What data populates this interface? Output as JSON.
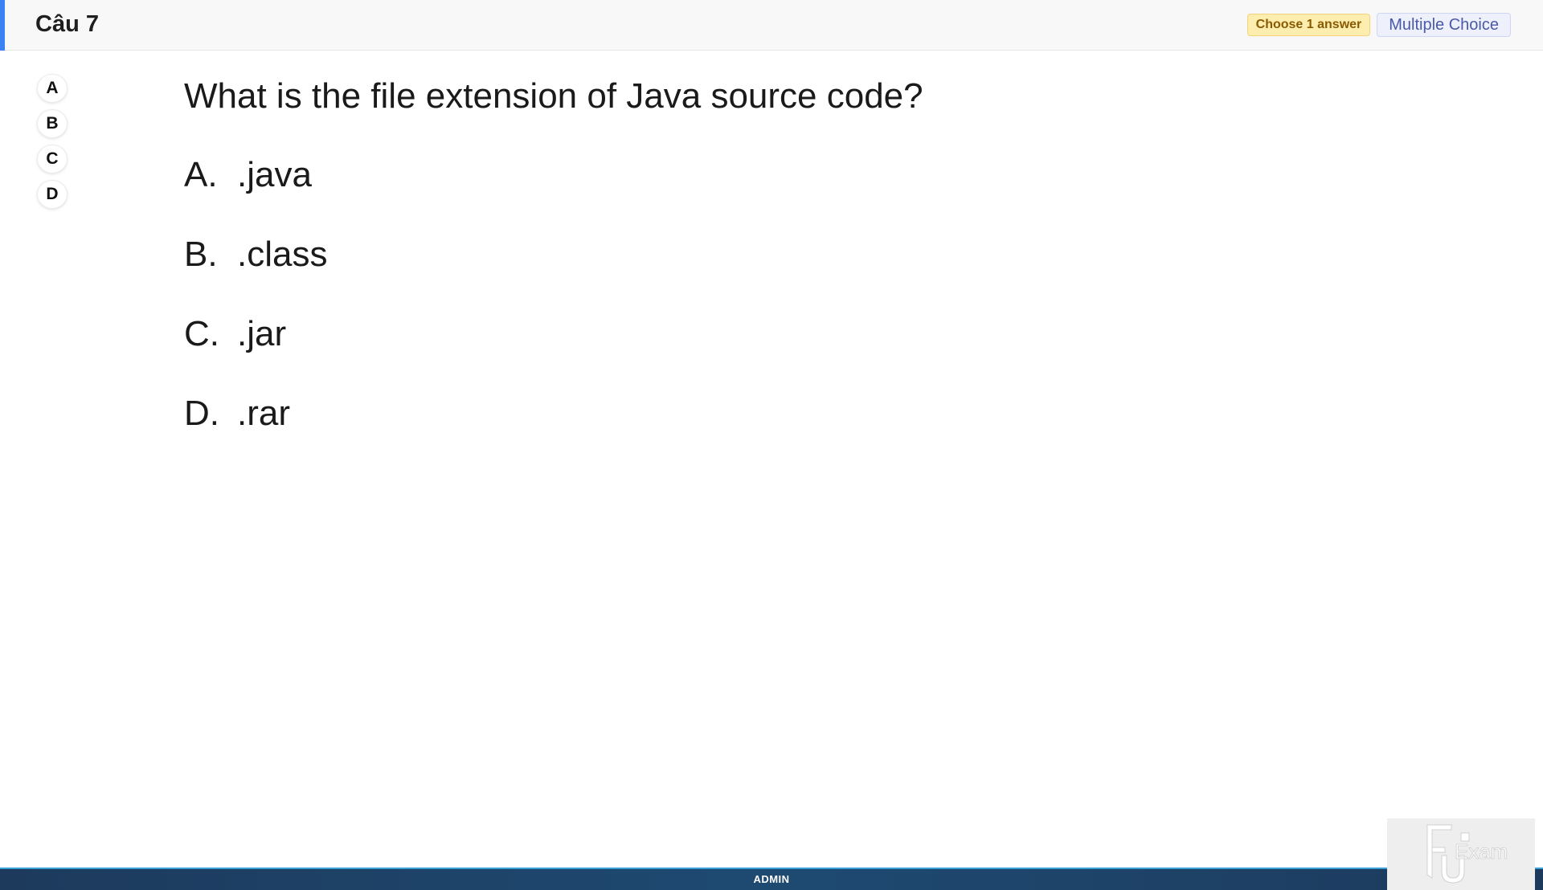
{
  "header": {
    "question_number": "Câu 7",
    "badge_choose": "Choose 1 answer",
    "badge_type": "Multiple Choice",
    "accent_color": "#3b82f6"
  },
  "answer_selectors": [
    {
      "label": "A"
    },
    {
      "label": "B"
    },
    {
      "label": "C"
    },
    {
      "label": "D"
    }
  ],
  "question": {
    "text": "What is the file extension of Java source code?",
    "options": [
      {
        "letter": "A.",
        "text": ".java"
      },
      {
        "letter": "B.",
        "text": ".class"
      },
      {
        "letter": "C.",
        "text": ".jar"
      },
      {
        "letter": "D.",
        "text": ".rar"
      }
    ]
  },
  "footer": {
    "label": "ADMIN"
  },
  "logo": {
    "icon": "fu-exam-logo",
    "text": "Exam"
  }
}
